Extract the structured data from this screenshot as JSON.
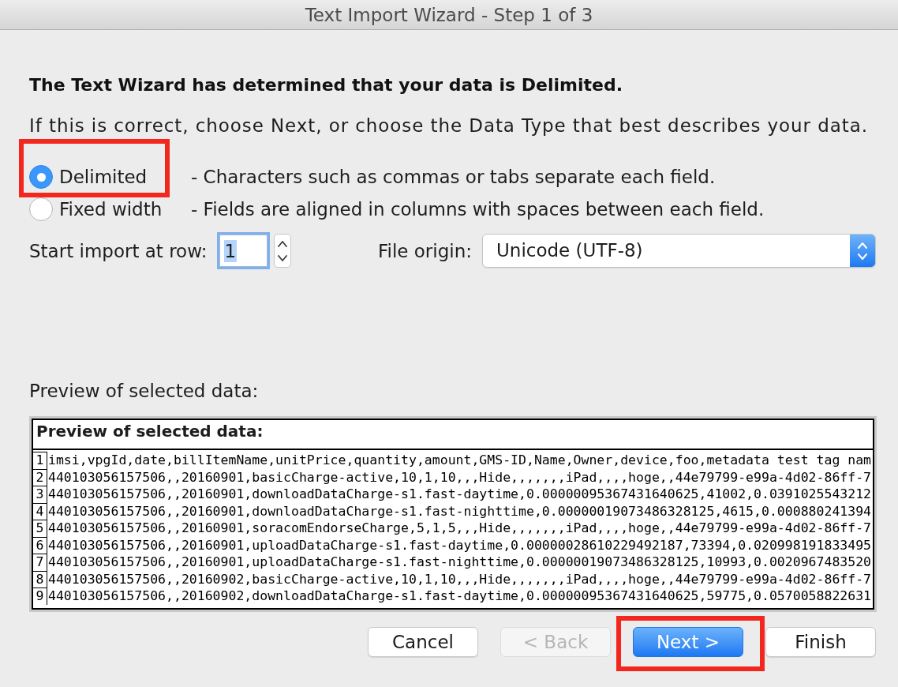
{
  "window": {
    "title": "Text Import Wizard - Step 1 of 3"
  },
  "heading": "The Text Wizard has determined that your data is Delimited.",
  "instruction": "If this is correct, choose Next, or choose the Data Type that best describes your data.",
  "data_type_options": [
    {
      "label": "Delimited",
      "description": "- Characters such as commas or tabs separate each field.",
      "selected": true,
      "highlighted": true
    },
    {
      "label": "Fixed width",
      "description": "- Fields are aligned in columns with spaces between each field.",
      "selected": false,
      "highlighted": false
    }
  ],
  "start_row": {
    "label": "Start import at row:",
    "value": "1",
    "focused": true
  },
  "file_origin": {
    "label": "File origin:",
    "value": "Unicode (UTF-8)"
  },
  "preview": {
    "label": "Preview of selected data:",
    "heading": "Preview of selected data:",
    "rows": [
      {
        "number": "1",
        "text": "imsi,vpgId,date,billItemName,unitPrice,quantity,amount,GMS-ID,Name,Owner,device,foo,metadata test tag nam"
      },
      {
        "number": "2",
        "text": "440103056157506,,20160901,basicCharge-active,10,1,10,,,Hide,,,,,,,iPad,,,,hoge,,44e79799-e99a-4d02-86ff-7"
      },
      {
        "number": "3",
        "text": "440103056157506,,20160901,downloadDataCharge-s1.fast-daytime,0.00000095367431640625,41002,0.0391025543212"
      },
      {
        "number": "4",
        "text": "440103056157506,,20160901,downloadDataCharge-s1.fast-nighttime,0.00000019073486328125,4615,0.000880241394"
      },
      {
        "number": "5",
        "text": "440103056157506,,20160901,soracomEndorseCharge,5,1,5,,,Hide,,,,,,,iPad,,,,hoge,,44e79799-e99a-4d02-86ff-7"
      },
      {
        "number": "6",
        "text": "440103056157506,,20160901,uploadDataCharge-s1.fast-daytime,0.00000028610229492187,73394,0.020998191833495"
      },
      {
        "number": "7",
        "text": "440103056157506,,20160901,uploadDataCharge-s1.fast-nighttime,0.00000019073486328125,10993,0.0020967483520"
      },
      {
        "number": "8",
        "text": "440103056157506,,20160902,basicCharge-active,10,1,10,,,Hide,,,,,,,iPad,,,,hoge,,44e79799-e99a-4d02-86ff-7"
      },
      {
        "number": "9",
        "text": "440103056157506,,20160902,downloadDataCharge-s1.fast-daytime,0.00000095367431640625,59775,0.0570058822631"
      }
    ]
  },
  "buttons": [
    {
      "label": "Cancel",
      "disabled": false,
      "default": false,
      "highlighted": false
    },
    {
      "label": "< Back",
      "disabled": true,
      "default": false,
      "highlighted": false
    },
    {
      "label": "Next >",
      "disabled": false,
      "default": true,
      "highlighted": true
    },
    {
      "label": "Finish",
      "disabled": false,
      "default": false,
      "highlighted": false
    }
  ]
}
